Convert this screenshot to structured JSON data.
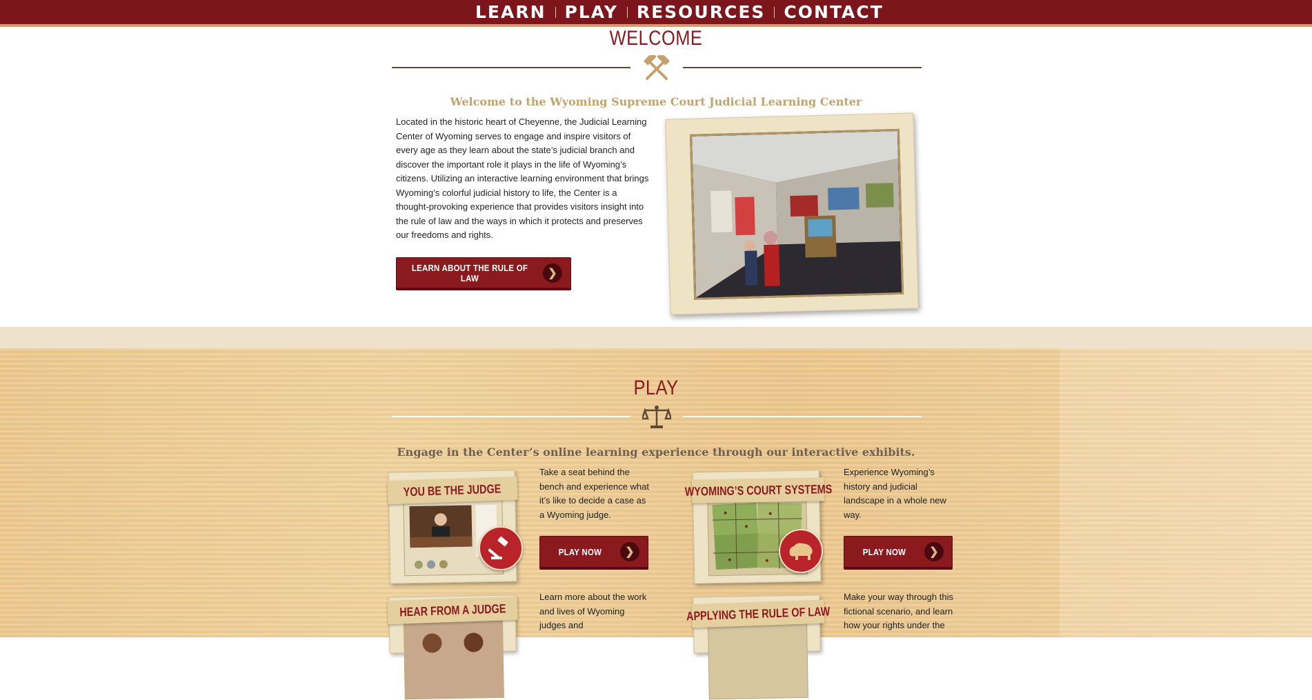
{
  "nav": {
    "items": [
      "LEARN",
      "PLAY",
      "RESOURCES",
      "CONTACT"
    ]
  },
  "welcome": {
    "title": "WELCOME",
    "subtitle": "Welcome to the Wyoming Supreme Court Judicial Learning Center",
    "body": "Located in the historic heart of Cheyenne, the Judicial Learning Center of Wyoming serves to engage and inspire visitors of every age as they learn about the state’s judicial branch and discover the important role it plays in the life of Wyoming’s citizens. Utilizing an interactive learning environment that brings Wyoming’s colorful judicial history to life, the Center is a thought-provoking experience that provides visitors insight into the rule of law and the ways in which it protects and preserves our freedoms and rights.",
    "button": "LEARN ABOUT THE RULE OF LAW",
    "image": "exhibit-hall-photo"
  },
  "play": {
    "title": "PLAY",
    "subtitle": "Engage in the Center’s online learning experience through our interactive exhibits.",
    "cards": [
      {
        "title": "YOU BE THE JUDGE",
        "description": "Take a seat behind the bench and experience what it’s like to decide a case as a Wyoming judge.",
        "button": "PLAY NOW",
        "icon": "gavel-icon"
      },
      {
        "title": "WYOMING’S COURT SYSTEMS",
        "description": "Experience Wyoming’s history and judicial landscape in a whole new way.",
        "button": "PLAY NOW",
        "icon": "bison-icon"
      },
      {
        "title": "HEAR FROM A JUDGE",
        "description": "Learn more about the work and lives of Wyoming judges and"
      },
      {
        "title": "APPLYING THE RULE OF LAW",
        "description": "Make your way through this fictional scenario, and learn how your rights under the"
      }
    ]
  },
  "colors": {
    "brand": "#8b1a1f",
    "accent": "#c8a071",
    "navbar": "#7d161c"
  }
}
